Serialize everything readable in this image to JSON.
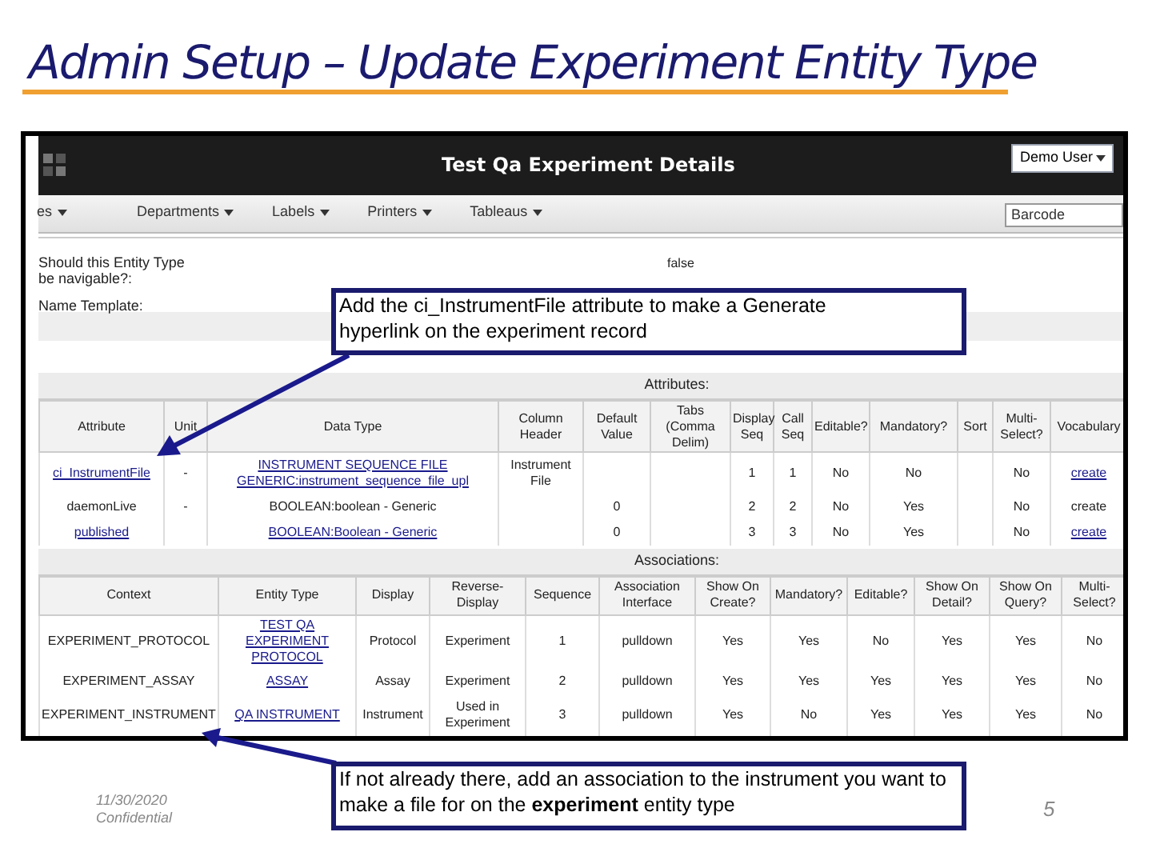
{
  "slide": {
    "title": "Admin Setup – Update Experiment Entity Type",
    "date": "11/30/2020",
    "confidentiality": "Confidential",
    "page_number": "5"
  },
  "app": {
    "page_title": "Test Qa Experiment Details",
    "user_menu": "Demo User",
    "nav": [
      "es",
      "Departments",
      "Labels",
      "Printers",
      "Tableaus"
    ],
    "search": {
      "placeholder": "Barcode"
    },
    "form": [
      {
        "label": "Should this Entity Type be navigable?:",
        "value": "false"
      },
      {
        "label": "Name Template:"
      }
    ],
    "attributes": {
      "heading": "Attributes:",
      "columns": [
        "Attribute",
        "Unit",
        "Data Type",
        "Column Header",
        "Default Value",
        "Tabs (Comma Delim)",
        "Display Seq",
        "Call Seq",
        "Editable?",
        "Mandatory?",
        "Sort",
        "Multi-Select?",
        "Vocabulary"
      ],
      "rows": [
        [
          {
            "text": "ci_InstrumentFile",
            "link": true
          },
          "-",
          {
            "text": "INSTRUMENT SEQUENCE FILE\nGENERIC:instrument_sequence_file_upl",
            "link": true
          },
          "Instrument File",
          "",
          "",
          "1",
          "1",
          "No",
          "No",
          "",
          "No",
          {
            "text": "create",
            "link": true
          }
        ],
        [
          "daemonLive",
          "-",
          "BOOLEAN:boolean - Generic",
          "",
          "0",
          "",
          "2",
          "2",
          "No",
          "Yes",
          "",
          "No",
          "create"
        ],
        [
          {
            "text": "published",
            "link": true
          },
          "",
          {
            "text": "BOOLEAN:Boolean - Generic",
            "link": true
          },
          "",
          "0",
          "",
          "3",
          "3",
          "No",
          "Yes",
          "",
          "No",
          {
            "text": "create",
            "link": true
          }
        ]
      ]
    },
    "associations": {
      "heading": "Associations:",
      "columns": [
        "Context",
        "Entity Type",
        "Display",
        "Reverse-Display",
        "Sequence",
        "Association Interface",
        "Show On Create?",
        "Mandatory?",
        "Editable?",
        "Show On Detail?",
        "Show On Query?",
        "Multi-Select?"
      ],
      "rows": [
        [
          "EXPERIMENT_PROTOCOL",
          {
            "text": "TEST QA EXPERIMENT PROTOCOL",
            "link": true
          },
          "Protocol",
          "Experiment",
          "1",
          "pulldown",
          "Yes",
          "Yes",
          "No",
          "Yes",
          "Yes",
          "No"
        ],
        [
          "EXPERIMENT_ASSAY",
          {
            "text": "ASSAY",
            "link": true
          },
          "Assay",
          "Experiment",
          "2",
          "pulldown",
          "Yes",
          "Yes",
          "Yes",
          "Yes",
          "Yes",
          "No"
        ],
        [
          "EXPERIMENT_INSTRUMENT",
          {
            "text": "QA INSTRUMENT",
            "link": true
          },
          "Instrument",
          "Used in Experiment",
          "3",
          "pulldown",
          "Yes",
          "No",
          "Yes",
          "Yes",
          "Yes",
          "No"
        ]
      ]
    }
  },
  "callouts": [
    {
      "text": "Add the ci_InstrumentFile attribute to make a Generate hyperlink on the experiment record"
    },
    {
      "text": "If not already there, add an association to the instrument you want to make a file for on the **experiment** entity type"
    }
  ]
}
